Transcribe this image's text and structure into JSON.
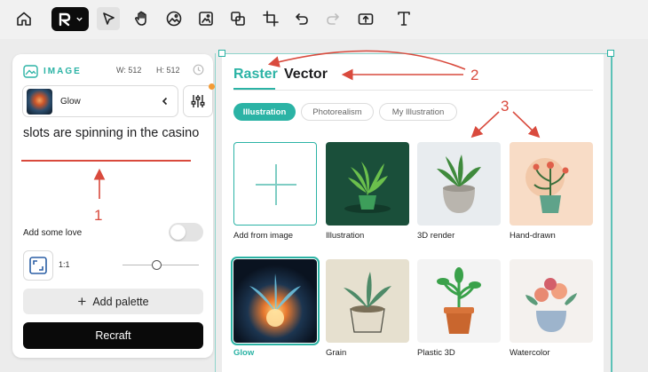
{
  "toolbar": {
    "icons": [
      "home-icon",
      "logo-icon",
      "select-cursor-icon",
      "hand-icon",
      "image-icon",
      "frame-image-icon",
      "layers-icon",
      "crop-icon",
      "undo-icon",
      "redo-icon",
      "export-icon",
      "text-icon"
    ]
  },
  "left_panel": {
    "title": "IMAGE",
    "width_label": "W:",
    "width_value": "512",
    "height_label": "H:",
    "height_value": "512",
    "style_name": "Glow",
    "prompt": "slots are spinning in the casino",
    "love_label": "Add some love",
    "love_enabled": false,
    "ratio_label": "1:1",
    "slider_fraction": 0.44,
    "palette_label": "Add palette",
    "submit_label": "Recraft"
  },
  "right_panel": {
    "tabs": [
      {
        "label": "Raster",
        "active": true
      },
      {
        "label": "Vector",
        "active": false
      }
    ],
    "chips": [
      {
        "label": "Illustration",
        "active": true
      },
      {
        "label": "Photorealism",
        "active": false
      },
      {
        "label": "My Illustration",
        "active": false
      }
    ],
    "cards": [
      {
        "label": "Add from image"
      },
      {
        "label": "Illustration"
      },
      {
        "label": "3D render"
      },
      {
        "label": "Hand-drawn"
      },
      {
        "label": "Glow",
        "selected": true
      },
      {
        "label": "Grain"
      },
      {
        "label": "Plastic 3D"
      },
      {
        "label": "Watercolor"
      }
    ]
  },
  "annotations": {
    "numbers": [
      "1",
      "2",
      "3"
    ],
    "color": "#d94a3d"
  },
  "colors": {
    "accent": "#2bb3a5",
    "dark_button": "#0a0a0a",
    "notification": "#f39b35"
  }
}
